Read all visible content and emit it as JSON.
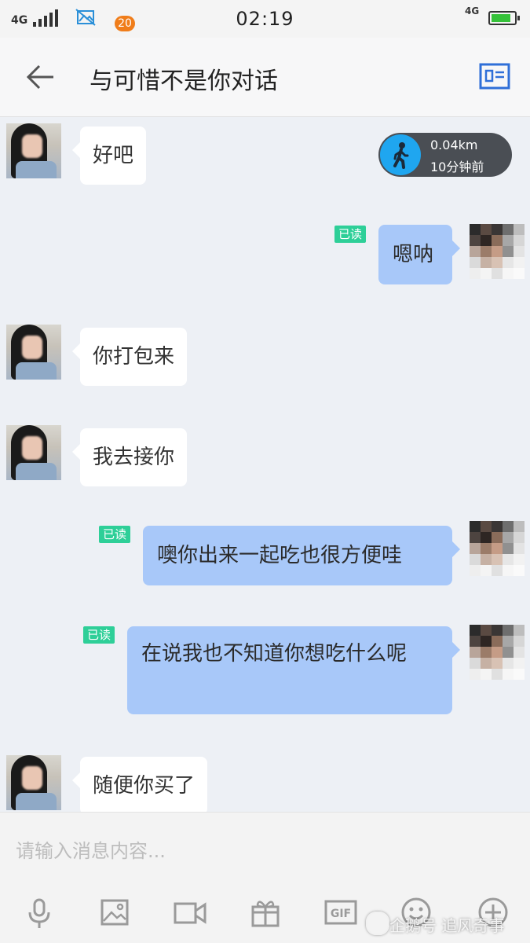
{
  "status_bar": {
    "network_left": "4G",
    "notification_count": "20",
    "time": "02:19",
    "network_right": "4G"
  },
  "header": {
    "title": "与可惜不是你对话",
    "back_icon": "back-arrow-icon",
    "profile_icon": "profile-card-icon"
  },
  "location": {
    "distance": "0.04km",
    "time_ago": "10分钟前",
    "icon": "walking-person-icon"
  },
  "messages": [
    {
      "side": "left",
      "text": "好吧"
    },
    {
      "side": "right",
      "text": "嗯呐",
      "status": "已读"
    },
    {
      "side": "left",
      "text": "你打包来"
    },
    {
      "side": "left",
      "text": "我去接你"
    },
    {
      "side": "right",
      "text": "噢你出来一起吃也很方便哇",
      "status": "已读"
    },
    {
      "side": "right",
      "text": "在说我也不知道你想吃什么呢",
      "status": "已读"
    },
    {
      "side": "left",
      "text": "随便你买了"
    }
  ],
  "input": {
    "placeholder": "请输入消息内容..."
  },
  "toolbar": {
    "items": [
      "microphone-icon",
      "image-icon",
      "video-icon",
      "gift-icon",
      "gif-icon",
      "emoji-icon",
      "plus-icon"
    ],
    "gif_label": "GIF"
  },
  "watermark": {
    "text": "企鹅号 追风奇事"
  },
  "colors": {
    "bubble_right": "#a8c8f9",
    "bubble_left": "#ffffff",
    "read_badge": "#2ecf98",
    "walk_circle": "#1fa6f0",
    "background": "#edf0f5"
  }
}
